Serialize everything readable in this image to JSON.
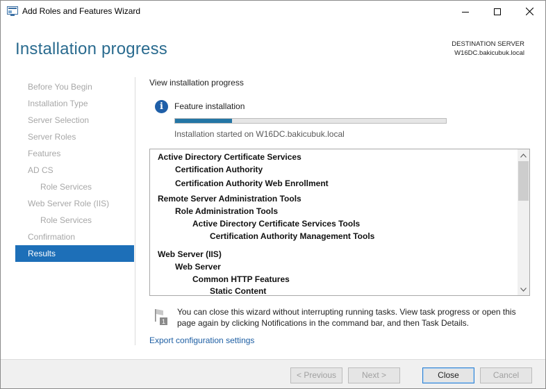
{
  "window": {
    "title": "Add Roles and Features Wizard"
  },
  "header": {
    "title": "Installation progress",
    "destination_label": "DESTINATION SERVER",
    "destination_server": "W16DC.bakicubuk.local"
  },
  "nav": {
    "items": [
      {
        "label": "Before You Begin",
        "level": 0,
        "active": false
      },
      {
        "label": "Installation Type",
        "level": 0,
        "active": false
      },
      {
        "label": "Server Selection",
        "level": 0,
        "active": false
      },
      {
        "label": "Server Roles",
        "level": 0,
        "active": false
      },
      {
        "label": "Features",
        "level": 0,
        "active": false
      },
      {
        "label": "AD CS",
        "level": 0,
        "active": false
      },
      {
        "label": "Role Services",
        "level": 1,
        "active": false
      },
      {
        "label": "Web Server Role (IIS)",
        "level": 0,
        "active": false
      },
      {
        "label": "Role Services",
        "level": 1,
        "active": false
      },
      {
        "label": "Confirmation",
        "level": 0,
        "active": false
      },
      {
        "label": "Results",
        "level": 0,
        "active": true
      }
    ]
  },
  "main": {
    "section_title": "View installation progress",
    "feature_label": "Feature installation",
    "progress_fraction": 0.21,
    "started_text": "Installation started on W16DC.bakicubuk.local",
    "results": [
      {
        "text": "Active Directory Certificate Services",
        "level": 0
      },
      {
        "text": "Certification Authority",
        "level": 1
      },
      {
        "text": "Certification Authority Web Enrollment",
        "level": 1
      },
      {
        "text": "Remote Server Administration Tools",
        "level": 0
      },
      {
        "text": "Role Administration Tools",
        "level": 1
      },
      {
        "text": "Active Directory Certificate Services Tools",
        "level": 2
      },
      {
        "text": "Certification Authority Management Tools",
        "level": 3
      },
      {
        "text": "Web Server (IIS)",
        "level": 0
      },
      {
        "text": "Web Server",
        "level": 1
      },
      {
        "text": "Common HTTP Features",
        "level": 2
      },
      {
        "text": "Static Content",
        "level": 3
      }
    ],
    "notice_text": "You can close this wizard without interrupting running tasks. View task progress or open this page again by clicking Notifications in the command bar, and then Task Details.",
    "notice_badge": "1",
    "export_link": "Export configuration settings"
  },
  "footer": {
    "previous": "< Previous",
    "next": "Next >",
    "close": "Close",
    "cancel": "Cancel"
  },
  "colors": {
    "accent": "#1d6fb8",
    "header_title": "#2a6b8f",
    "progress": "#2476a5",
    "link": "#1d5ea3"
  }
}
